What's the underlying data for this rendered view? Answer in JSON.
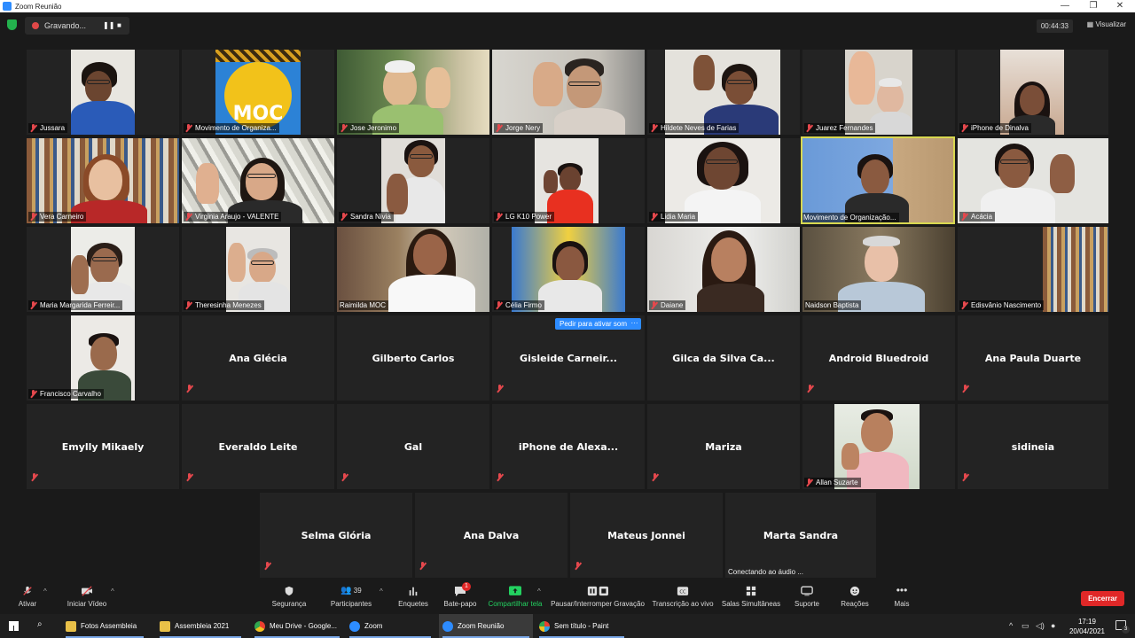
{
  "window": {
    "title": "Zoom Reunião",
    "controls": {
      "minimize": "—",
      "restore": "❐",
      "close": "✕"
    }
  },
  "topbar": {
    "recording": "Gravando...",
    "timer": "00:44:33",
    "view": "Visualizar"
  },
  "participants": {
    "video": [
      {
        "name": "Jussara",
        "muted": true
      },
      {
        "name": "Movimento de Organiza...",
        "muted": true
      },
      {
        "name": "Jose Jeronimo",
        "muted": true
      },
      {
        "name": "Jorge Nery",
        "muted": true
      },
      {
        "name": "Hildete Neves de Farias",
        "muted": true
      },
      {
        "name": "Juarez Fernandes",
        "muted": true
      },
      {
        "name": "iPhone de Dinalva",
        "muted": true
      },
      {
        "name": "Vera Carneiro",
        "muted": true
      },
      {
        "name": "Virginia Araujo - VALENTE",
        "muted": true
      },
      {
        "name": "Sandra Nivia",
        "muted": true
      },
      {
        "name": "LG K10 Power",
        "muted": true
      },
      {
        "name": "Lidia Maria",
        "muted": true
      },
      {
        "name": "Movimento de Organização...",
        "muted": false
      },
      {
        "name": "Acácia",
        "muted": true
      },
      {
        "name": "Maria Margarida Ferreir...",
        "muted": true
      },
      {
        "name": "Theresinha Menezes",
        "muted": true
      },
      {
        "name": "Raimilda MOC",
        "muted": false
      },
      {
        "name": "Célia Firmo",
        "muted": true
      },
      {
        "name": "Daiane",
        "muted": true
      },
      {
        "name": "Naidson Baptista",
        "muted": false
      },
      {
        "name": "Edisvânio Nascimento",
        "muted": true
      },
      {
        "name": "Francisco Carvalho",
        "muted": true
      },
      {
        "name": "Allan Suzarte",
        "muted": true
      }
    ],
    "no_video": [
      {
        "name": "Ana Glécia"
      },
      {
        "name": "Gilberto Carlos"
      },
      {
        "name": "Gisleide Carneir..."
      },
      {
        "name": "Gilca da Silva Ca..."
      },
      {
        "name": "Android Bluedroid"
      },
      {
        "name": "Ana Paula Duarte"
      },
      {
        "name": "Emylly Mikaely"
      },
      {
        "name": "Everaldo Leite"
      },
      {
        "name": "Gal"
      },
      {
        "name": "iPhone de Alexa..."
      },
      {
        "name": "Mariza"
      },
      {
        "name": "sidineia"
      },
      {
        "name": "Selma Glória"
      },
      {
        "name": "Ana Dalva"
      },
      {
        "name": "Mateus Jonnei"
      },
      {
        "name": "Marta Sandra"
      }
    ],
    "moc_logo_text": "MOC",
    "connecting": "Conectando ao áudio ...",
    "ask_unmute": "Pedir para ativar som",
    "ask_more": "···"
  },
  "toolbar": {
    "mute": "Ativar",
    "start_video": "Iniciar Vídeo",
    "security": "Segurança",
    "participants": "Participantes",
    "participants_count": "39",
    "polls": "Enquetes",
    "chat": "Bate-papo",
    "chat_badge": "1",
    "share": "Compartilhar tela",
    "pause_rec": "Pausar/Interromper Gravação",
    "transcription": "Transcrição ao vivo",
    "breakout": "Salas Simultâneas",
    "support": "Suporte",
    "reactions": "Reações",
    "more": "Mais",
    "end": "Encerrar"
  },
  "taskbar": {
    "items": [
      "Fotos Assembleia",
      "Assembleia 2021",
      "Meu Drive - Google...",
      "Zoom",
      "Zoom Reunião",
      "Sem título - Paint"
    ],
    "time": "17:19",
    "date": "20/04/2021",
    "notif_count": "3"
  }
}
